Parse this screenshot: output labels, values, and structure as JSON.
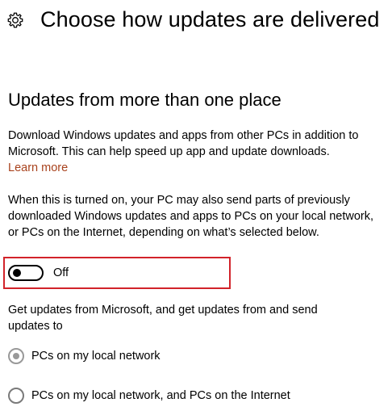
{
  "header": {
    "icon": "gear-icon",
    "title": "Choose how updates are delivered"
  },
  "section": {
    "title": "Updates from more than one place"
  },
  "description": "Download Windows updates and apps from other PCs in addition to Microsoft. This can help speed up app and update downloads.",
  "learn_more": "Learn more",
  "detail": "When this is turned on, your PC may also send parts of previously downloaded Windows updates and apps to PCs on your local network, or PCs on the Internet, depending on what’s selected below.",
  "toggle": {
    "state": "off",
    "label": "Off"
  },
  "get_updates_text": "Get updates from Microsoft, and get updates from and send updates to",
  "options": [
    {
      "label": "PCs on my local network",
      "selected": true,
      "disabled": true
    },
    {
      "label": "PCs on my local network, and PCs on the Internet",
      "selected": false,
      "disabled": true
    }
  ],
  "colors": {
    "link": "#a8421d",
    "highlight_border": "#d2232a",
    "radio_disabled": "#999999"
  }
}
